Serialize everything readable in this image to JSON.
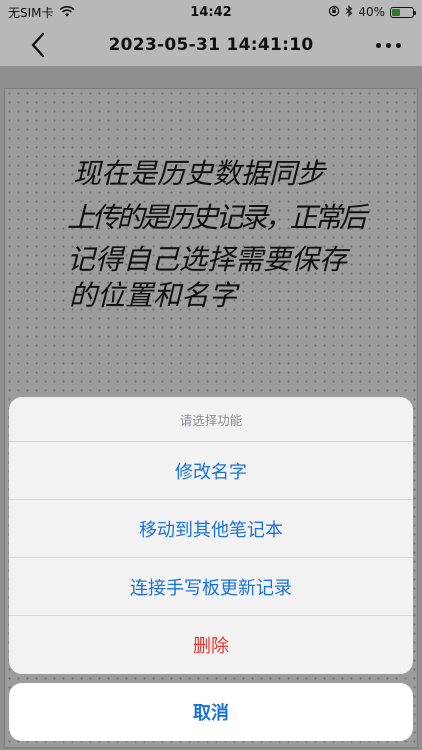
{
  "status_bar": {
    "carrier": "无SIM卡",
    "time": "14:42",
    "battery_percent": "40%",
    "battery_level": 0.4,
    "battery_color": "#2a7a2a"
  },
  "nav": {
    "title": "2023-05-31 14:41:10"
  },
  "note": {
    "handwriting_lines": [
      "现在是历史数据同步",
      "上传的是历史记录，正常后",
      "记得自己选择需要保存",
      "的位置和名字"
    ]
  },
  "action_sheet": {
    "title": "请选择功能",
    "items": [
      {
        "label": "修改名字",
        "destructive": false
      },
      {
        "label": "移动到其他笔记本",
        "destructive": false
      },
      {
        "label": "连接手写板更新记录",
        "destructive": false
      },
      {
        "label": "删除",
        "destructive": true
      }
    ],
    "cancel_label": "取消"
  },
  "colors": {
    "accent": "#1a73d9",
    "destructive": "#e8362c"
  },
  "icons": {
    "wifi": "wifi-icon",
    "orientation_lock": "orientation-lock-icon",
    "bluetooth": "bluetooth-icon",
    "battery": "battery-icon",
    "back": "chevron-left-icon",
    "more": "more-icon"
  }
}
